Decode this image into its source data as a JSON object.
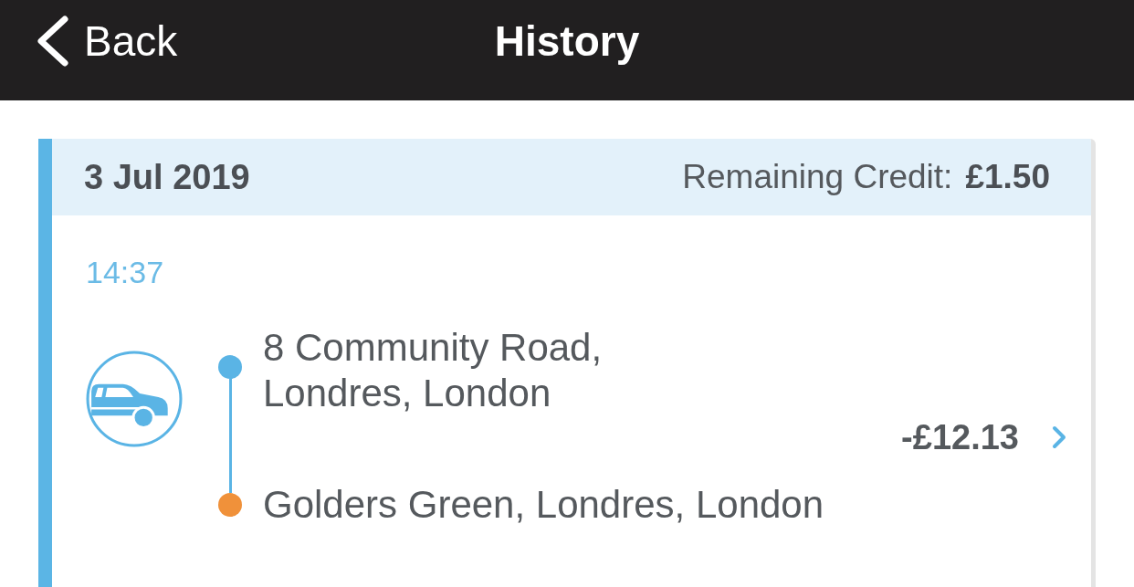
{
  "nav": {
    "back": "Back",
    "title": "History"
  },
  "trips": [
    {
      "date": "3 Jul 2019",
      "credit_label": "Remaining Credit:",
      "credit_value": "£1.50",
      "time": "14:37",
      "stops": [
        {
          "kind": "pickup",
          "address": "8 Community Road, Londres, London",
          "color": "#5ab4e5"
        },
        {
          "kind": "dropoff",
          "address": "Golders Green, Londres, London",
          "color": "#f0913a"
        }
      ],
      "amount": "-£12.13"
    }
  ]
}
